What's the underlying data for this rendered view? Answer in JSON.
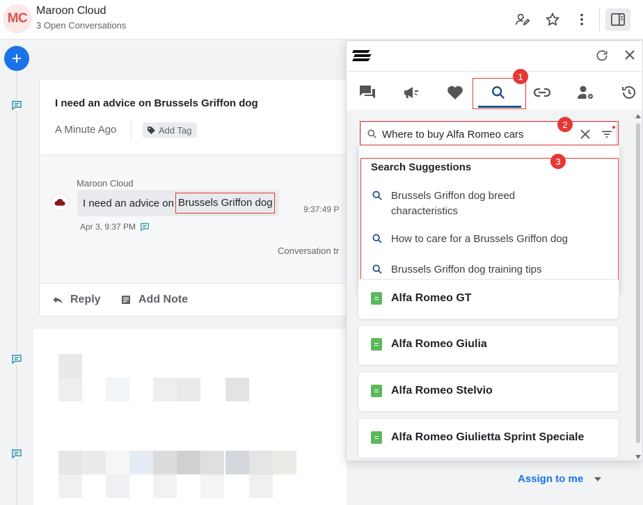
{
  "header": {
    "avatar_initials": "MC",
    "title": "Maroon Cloud",
    "subtitle": "3 Open Conversations"
  },
  "conversation": {
    "title": "I need an advice on Brussels Griffon dog",
    "time_ago": "A Minute Ago",
    "add_tag_label": "Add Tag",
    "message": {
      "author": "Maroon Cloud",
      "text_before": "I need an advice on",
      "text_highlight": "Brussels Griffon dog",
      "time": "9:37:49 P",
      "date": "Apr 3, 9:37 PM"
    },
    "transfer_text": "Conversation tr",
    "reply_label": "Reply",
    "add_note_label": "Add Note"
  },
  "assign_label": "Assign to me",
  "panel": {
    "search_value": "Where to buy Alfa Romeo cars",
    "suggestions_title": "Search Suggestions",
    "suggestions": [
      "Brussels Griffon dog breed characteristics",
      "How to care for a Brussels Griffon dog",
      "Brussels Griffon dog training tips"
    ],
    "results": [
      "Alfa Romeo GT",
      "Alfa Romeo Giulia",
      "Alfa Romeo Stelvio",
      "Alfa Romeo Giulietta Sprint Speciale"
    ],
    "annotations": [
      "1",
      "2",
      "3"
    ]
  },
  "colors": {
    "accent": "#1a73e8",
    "annotation_red": "#e53935",
    "result_icon": "#5cb85c",
    "avatar_text": "#d9534f"
  }
}
